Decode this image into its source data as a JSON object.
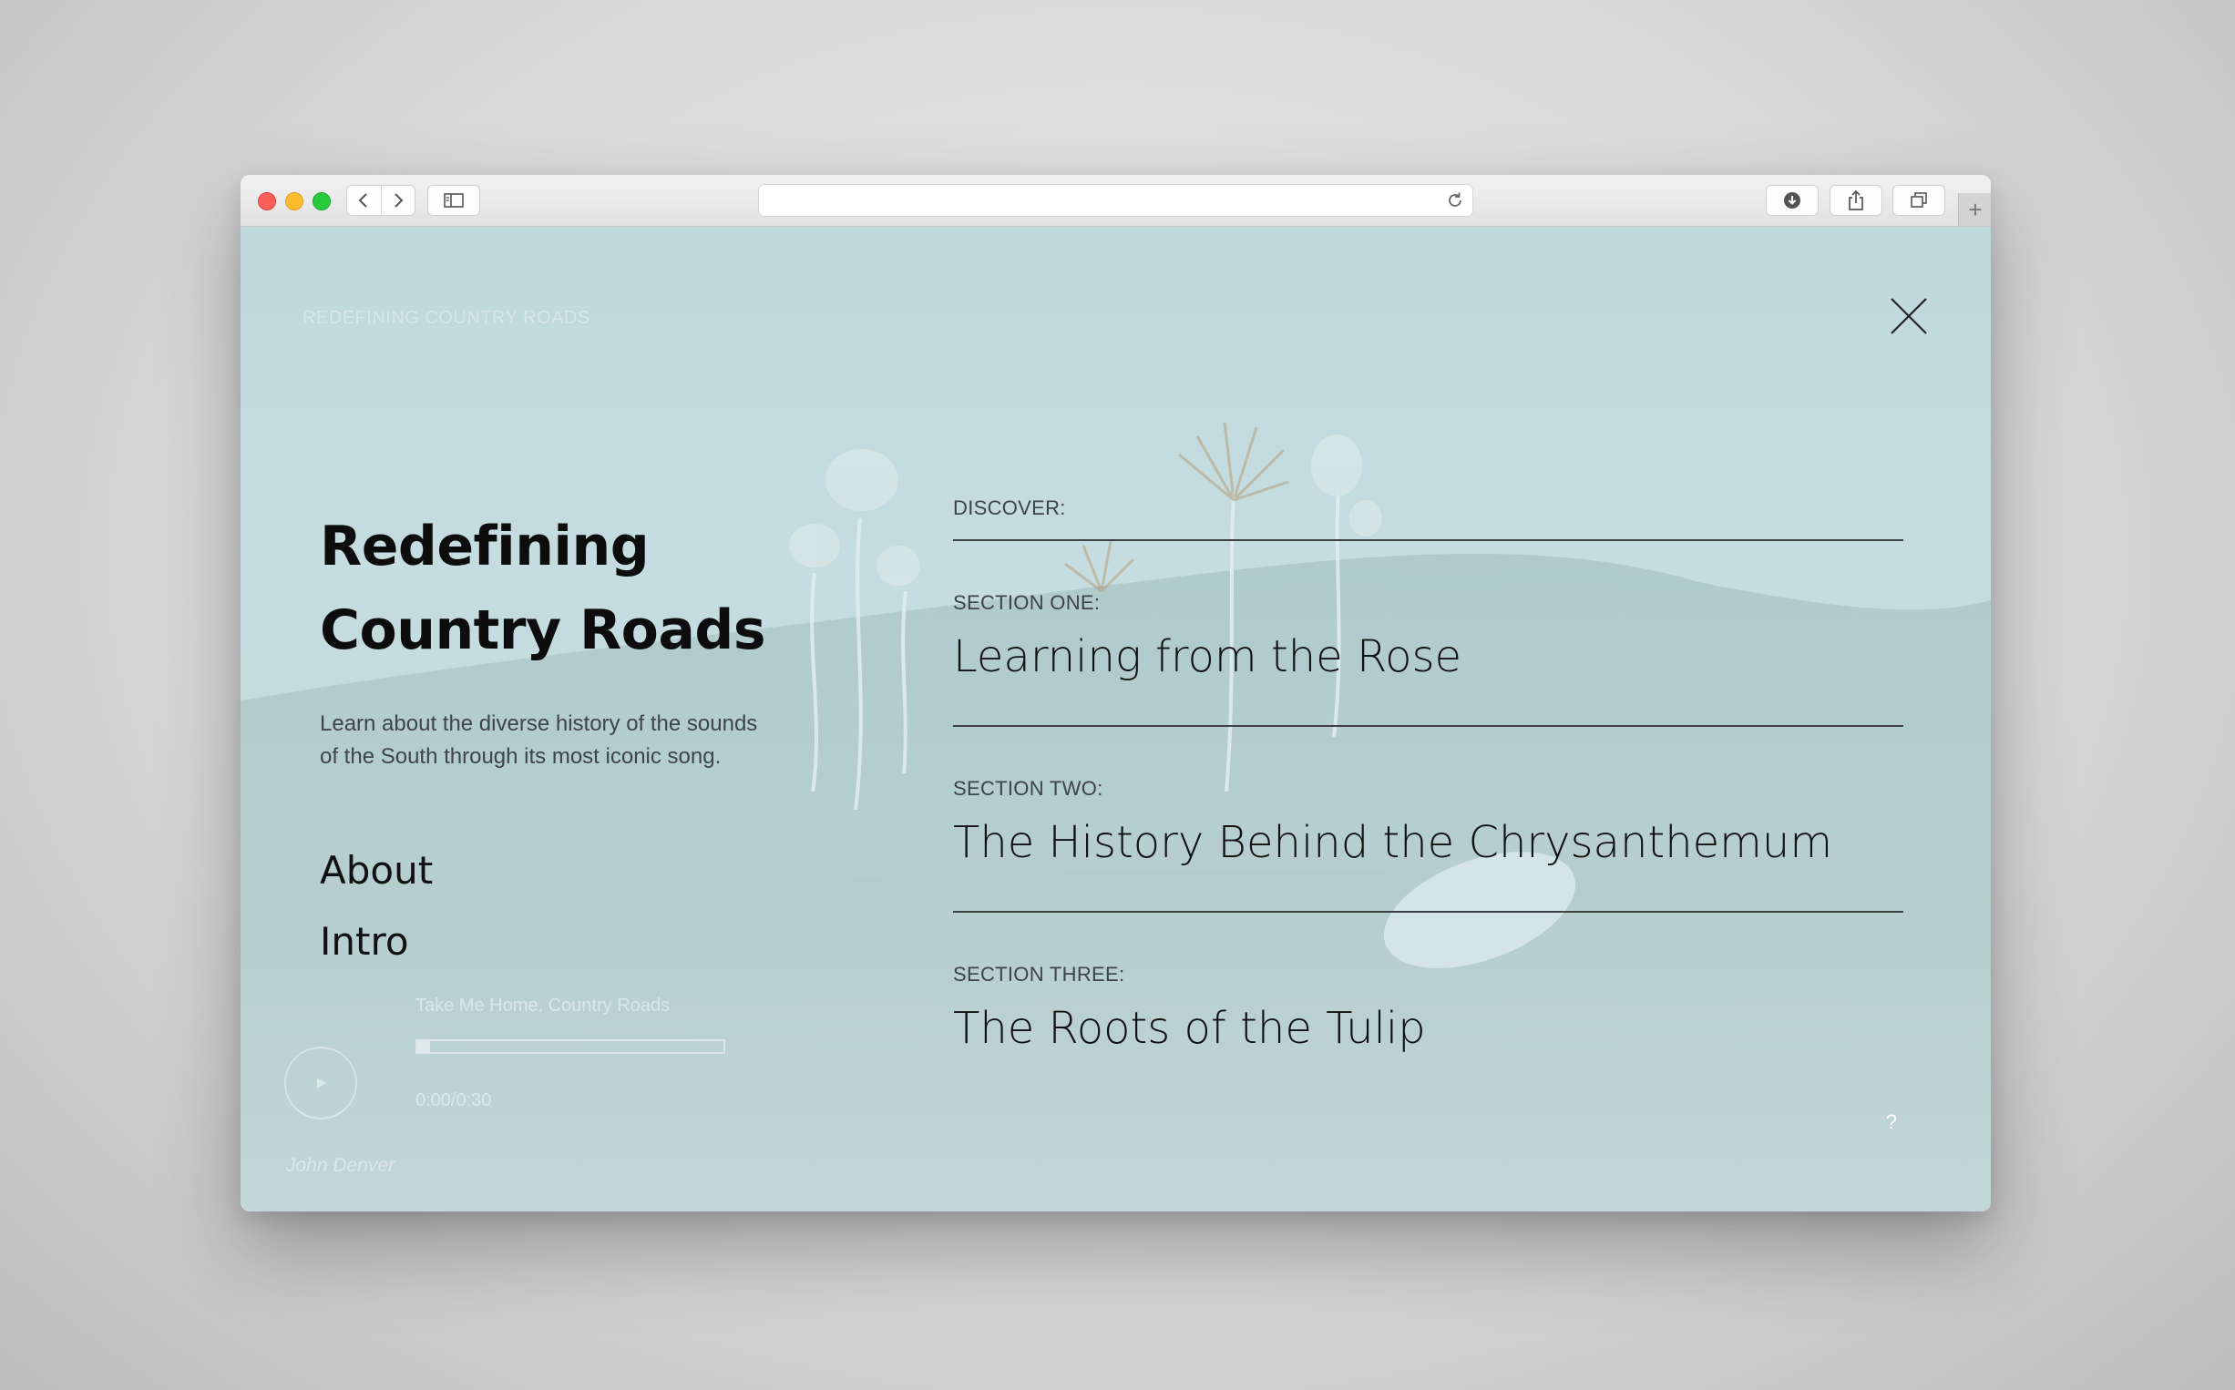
{
  "browser": {
    "address_value": "",
    "icons": [
      "back-icon",
      "forward-icon",
      "sidebar-icon",
      "reload-icon",
      "download-icon",
      "share-icon",
      "tabs-icon",
      "new-tab-icon"
    ],
    "new_tab_label": "+"
  },
  "page": {
    "brand": "REDEFINING COUNTRY ROADS",
    "title_line1": "Redefining",
    "title_line2": "Country Roads",
    "description_line1": "Learn about the diverse history of the sounds",
    "description_line2": "of the South through its most iconic song.",
    "nav": {
      "about": "About",
      "intro": "Intro"
    },
    "player": {
      "track": "Take Me Home, Country Roads",
      "time": "0:00/0:30",
      "progress": 0.0
    },
    "artist": "John Denver",
    "discover_label": "DISCOVER:",
    "sections": [
      {
        "label": "SECTION ONE:",
        "title": "Learning from the Rose"
      },
      {
        "label": "SECTION TWO:",
        "title": "The History Behind the Chrysanthemum"
      },
      {
        "label": "SECTION THREE:",
        "title": "The Roots of the Tulip"
      }
    ],
    "help": "?"
  },
  "colors": {
    "background_tint": "#c3dade",
    "title_text": "#0d0d0d",
    "rule": "#3b4244"
  }
}
